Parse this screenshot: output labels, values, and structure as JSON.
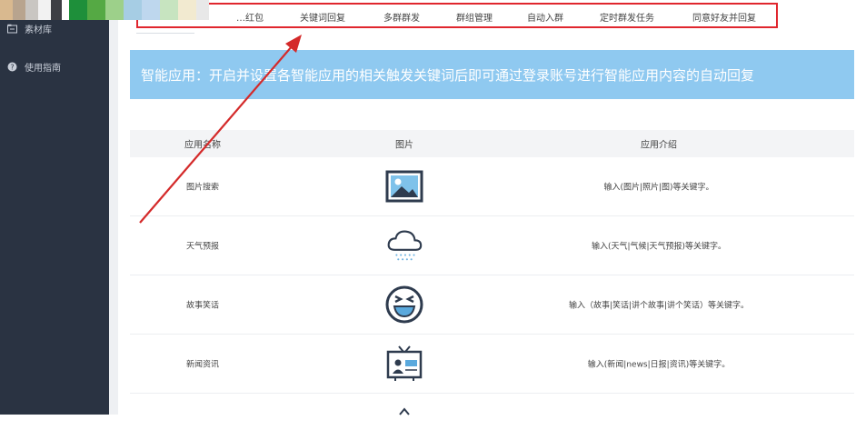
{
  "sidebar": {
    "items": [
      {
        "label": "素材库",
        "icon": "folder-icon"
      },
      {
        "label": "使用指南",
        "icon": "help-circle-icon"
      }
    ]
  },
  "tabs": [
    "…红包",
    "关键词回复",
    "多群群发",
    "群组管理",
    "自动入群",
    "定时群发任务",
    "同意好友并回复"
  ],
  "banner": {
    "text": "智能应用：开启并设置各智能应用的相关触发关键词后即可通过登录账号进行智能应用内容的自动回复"
  },
  "table": {
    "headers": [
      "应用名称",
      "图片",
      "应用介绍"
    ],
    "rows": [
      {
        "name": "图片搜索",
        "icon": "image-icon",
        "desc": "输入(图片|照片|图)等关键字。"
      },
      {
        "name": "天气预报",
        "icon": "cloud-rain-icon",
        "desc": "输入(天气|气候|天气预报)等关键字。"
      },
      {
        "name": "故事笑话",
        "icon": "laughing-face-icon",
        "desc": "输入（故事|笑话|讲个故事|讲个笑话）等关键字。"
      },
      {
        "name": "新闻资讯",
        "icon": "tv-news-icon",
        "desc": "输入(新闻|news|日报|资讯)等关键字。"
      }
    ]
  },
  "colors": {
    "sidebar_bg": "#2a3342",
    "banner_bg": "#8fc9f0",
    "annotation_red": "#d42a2a"
  }
}
